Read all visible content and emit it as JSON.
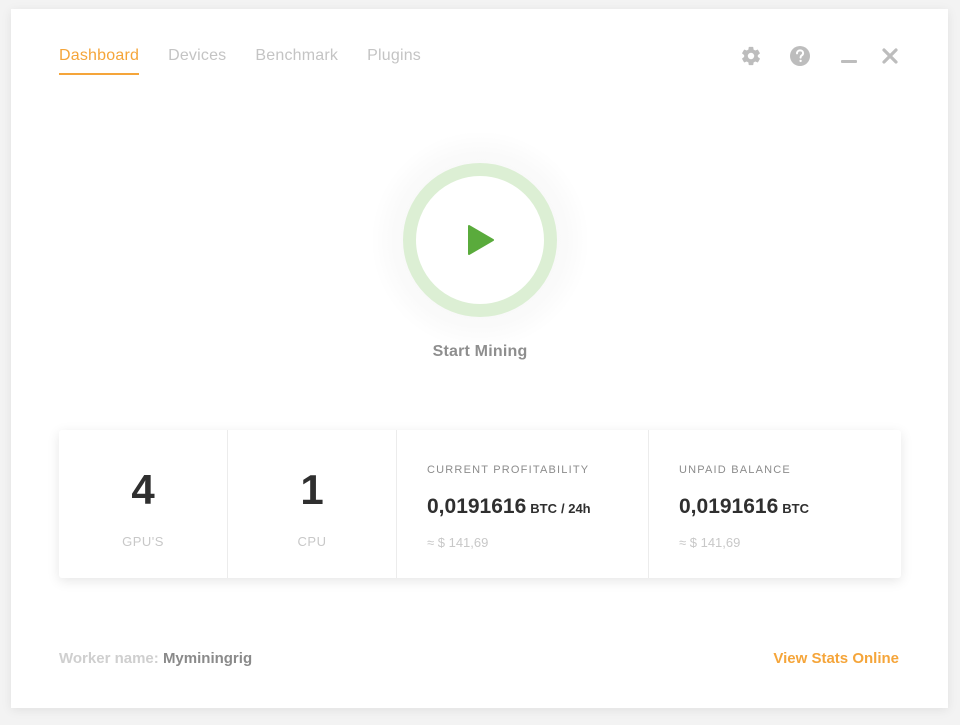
{
  "nav": {
    "tabs": [
      {
        "label": "Dashboard",
        "active": true
      },
      {
        "label": "Devices",
        "active": false
      },
      {
        "label": "Benchmark",
        "active": false
      },
      {
        "label": "Plugins",
        "active": false
      }
    ]
  },
  "window_controls": {
    "icons": [
      "gear-icon",
      "help-icon",
      "minimize-icon",
      "close-icon"
    ]
  },
  "start": {
    "label": "Start Mining",
    "icon": "play-icon"
  },
  "stats": {
    "gpus": {
      "value": "4",
      "label": "GPU'S"
    },
    "cpu": {
      "value": "1",
      "label": "CPU"
    },
    "profitability": {
      "title": "CURRENT PROFITABILITY",
      "amount": "0,0191616",
      "unit": "BTC",
      "period": "/ 24h",
      "fiat": "≈ $ 141,69"
    },
    "balance": {
      "title": "UNPAID BALANCE",
      "amount": "0,0191616",
      "unit": "BTC",
      "fiat": "≈ $ 141,69"
    }
  },
  "footer": {
    "worker_label": "Worker name:",
    "worker_name": "Myminingrig",
    "view_stats": "View Stats Online"
  },
  "colors": {
    "accent": "#f5a53a",
    "play": "#5aab3c",
    "ring": "#dcefd4"
  }
}
